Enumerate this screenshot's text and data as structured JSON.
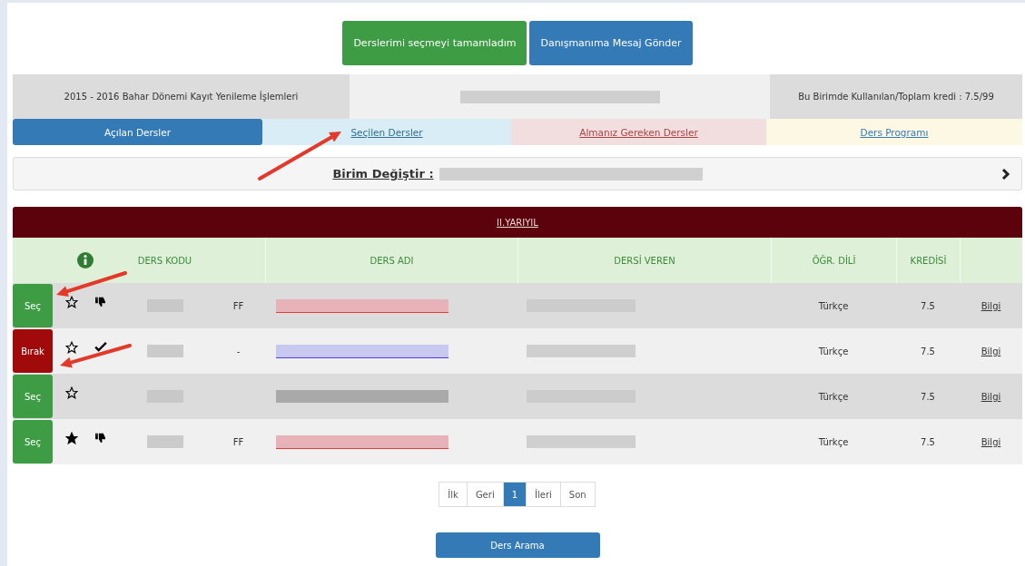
{
  "top_buttons": [
    {
      "label": "Derslerimi seçmeyi tamamladım",
      "kind": "success"
    },
    {
      "label": "Danışmanıma Mesaj Gönder",
      "kind": "primary"
    }
  ],
  "info_bar": {
    "term": "2015 - 2016 Bahar Dönemi Kayıt Yenileme İşlemleri",
    "credit": "Bu Birimde Kullanılan/Toplam kredi : 7.5/99"
  },
  "tabs": [
    {
      "label": "Açılan Dersler",
      "kind": "primary",
      "selected": true
    },
    {
      "label": "Seçilen Dersler",
      "kind": "info",
      "selected": false
    },
    {
      "label": "Almanız Gereken Dersler",
      "kind": "danger",
      "selected": false
    },
    {
      "label": "Ders Programı",
      "kind": "warning",
      "selected": false
    }
  ],
  "unit_bar": {
    "label": "Birim Değiştir :"
  },
  "table": {
    "caption": "II.YARIYIL",
    "columns": [
      "DERS KODU",
      "DERS ADI",
      "DERSİ VEREN",
      "ÖĞR. DİLİ",
      "KREDİSİ"
    ],
    "rows": [
      {
        "action": {
          "label": "Seç",
          "kind": "select"
        },
        "starred": false,
        "feedback": {
          "kind": "dislike"
        },
        "grade": "FF",
        "course_name": {
          "kind": "failed"
        },
        "language": "Türkçe",
        "credit": "7.5",
        "link": "Bilgi"
      },
      {
        "action": {
          "label": "Bırak",
          "kind": "drop"
        },
        "starred": false,
        "feedback": {
          "kind": "check"
        },
        "grade": "-",
        "course_name": {
          "kind": "chosen"
        },
        "language": "Türkçe",
        "credit": "7.5",
        "link": "Bilgi"
      },
      {
        "action": {
          "label": "Seç",
          "kind": "select"
        },
        "starred": false,
        "course_name": {
          "kind": "plain"
        },
        "language": "Türkçe",
        "credit": "7.5",
        "link": "Bilgi"
      },
      {
        "action": {
          "label": "Seç",
          "kind": "select"
        },
        "starred": true,
        "feedback": {
          "kind": "dislike"
        },
        "grade": "FF",
        "course_name": {
          "kind": "failed"
        },
        "language": "Türkçe",
        "credit": "7.5",
        "link": "Bilgi"
      }
    ]
  },
  "pagination": [
    {
      "label": "İlk",
      "selected": false
    },
    {
      "label": "Geri",
      "selected": false
    },
    {
      "label": "1",
      "selected": true
    },
    {
      "label": "İleri",
      "selected": false
    },
    {
      "label": "Son",
      "selected": false
    }
  ],
  "search_button": {
    "label": "Ders Arama"
  }
}
